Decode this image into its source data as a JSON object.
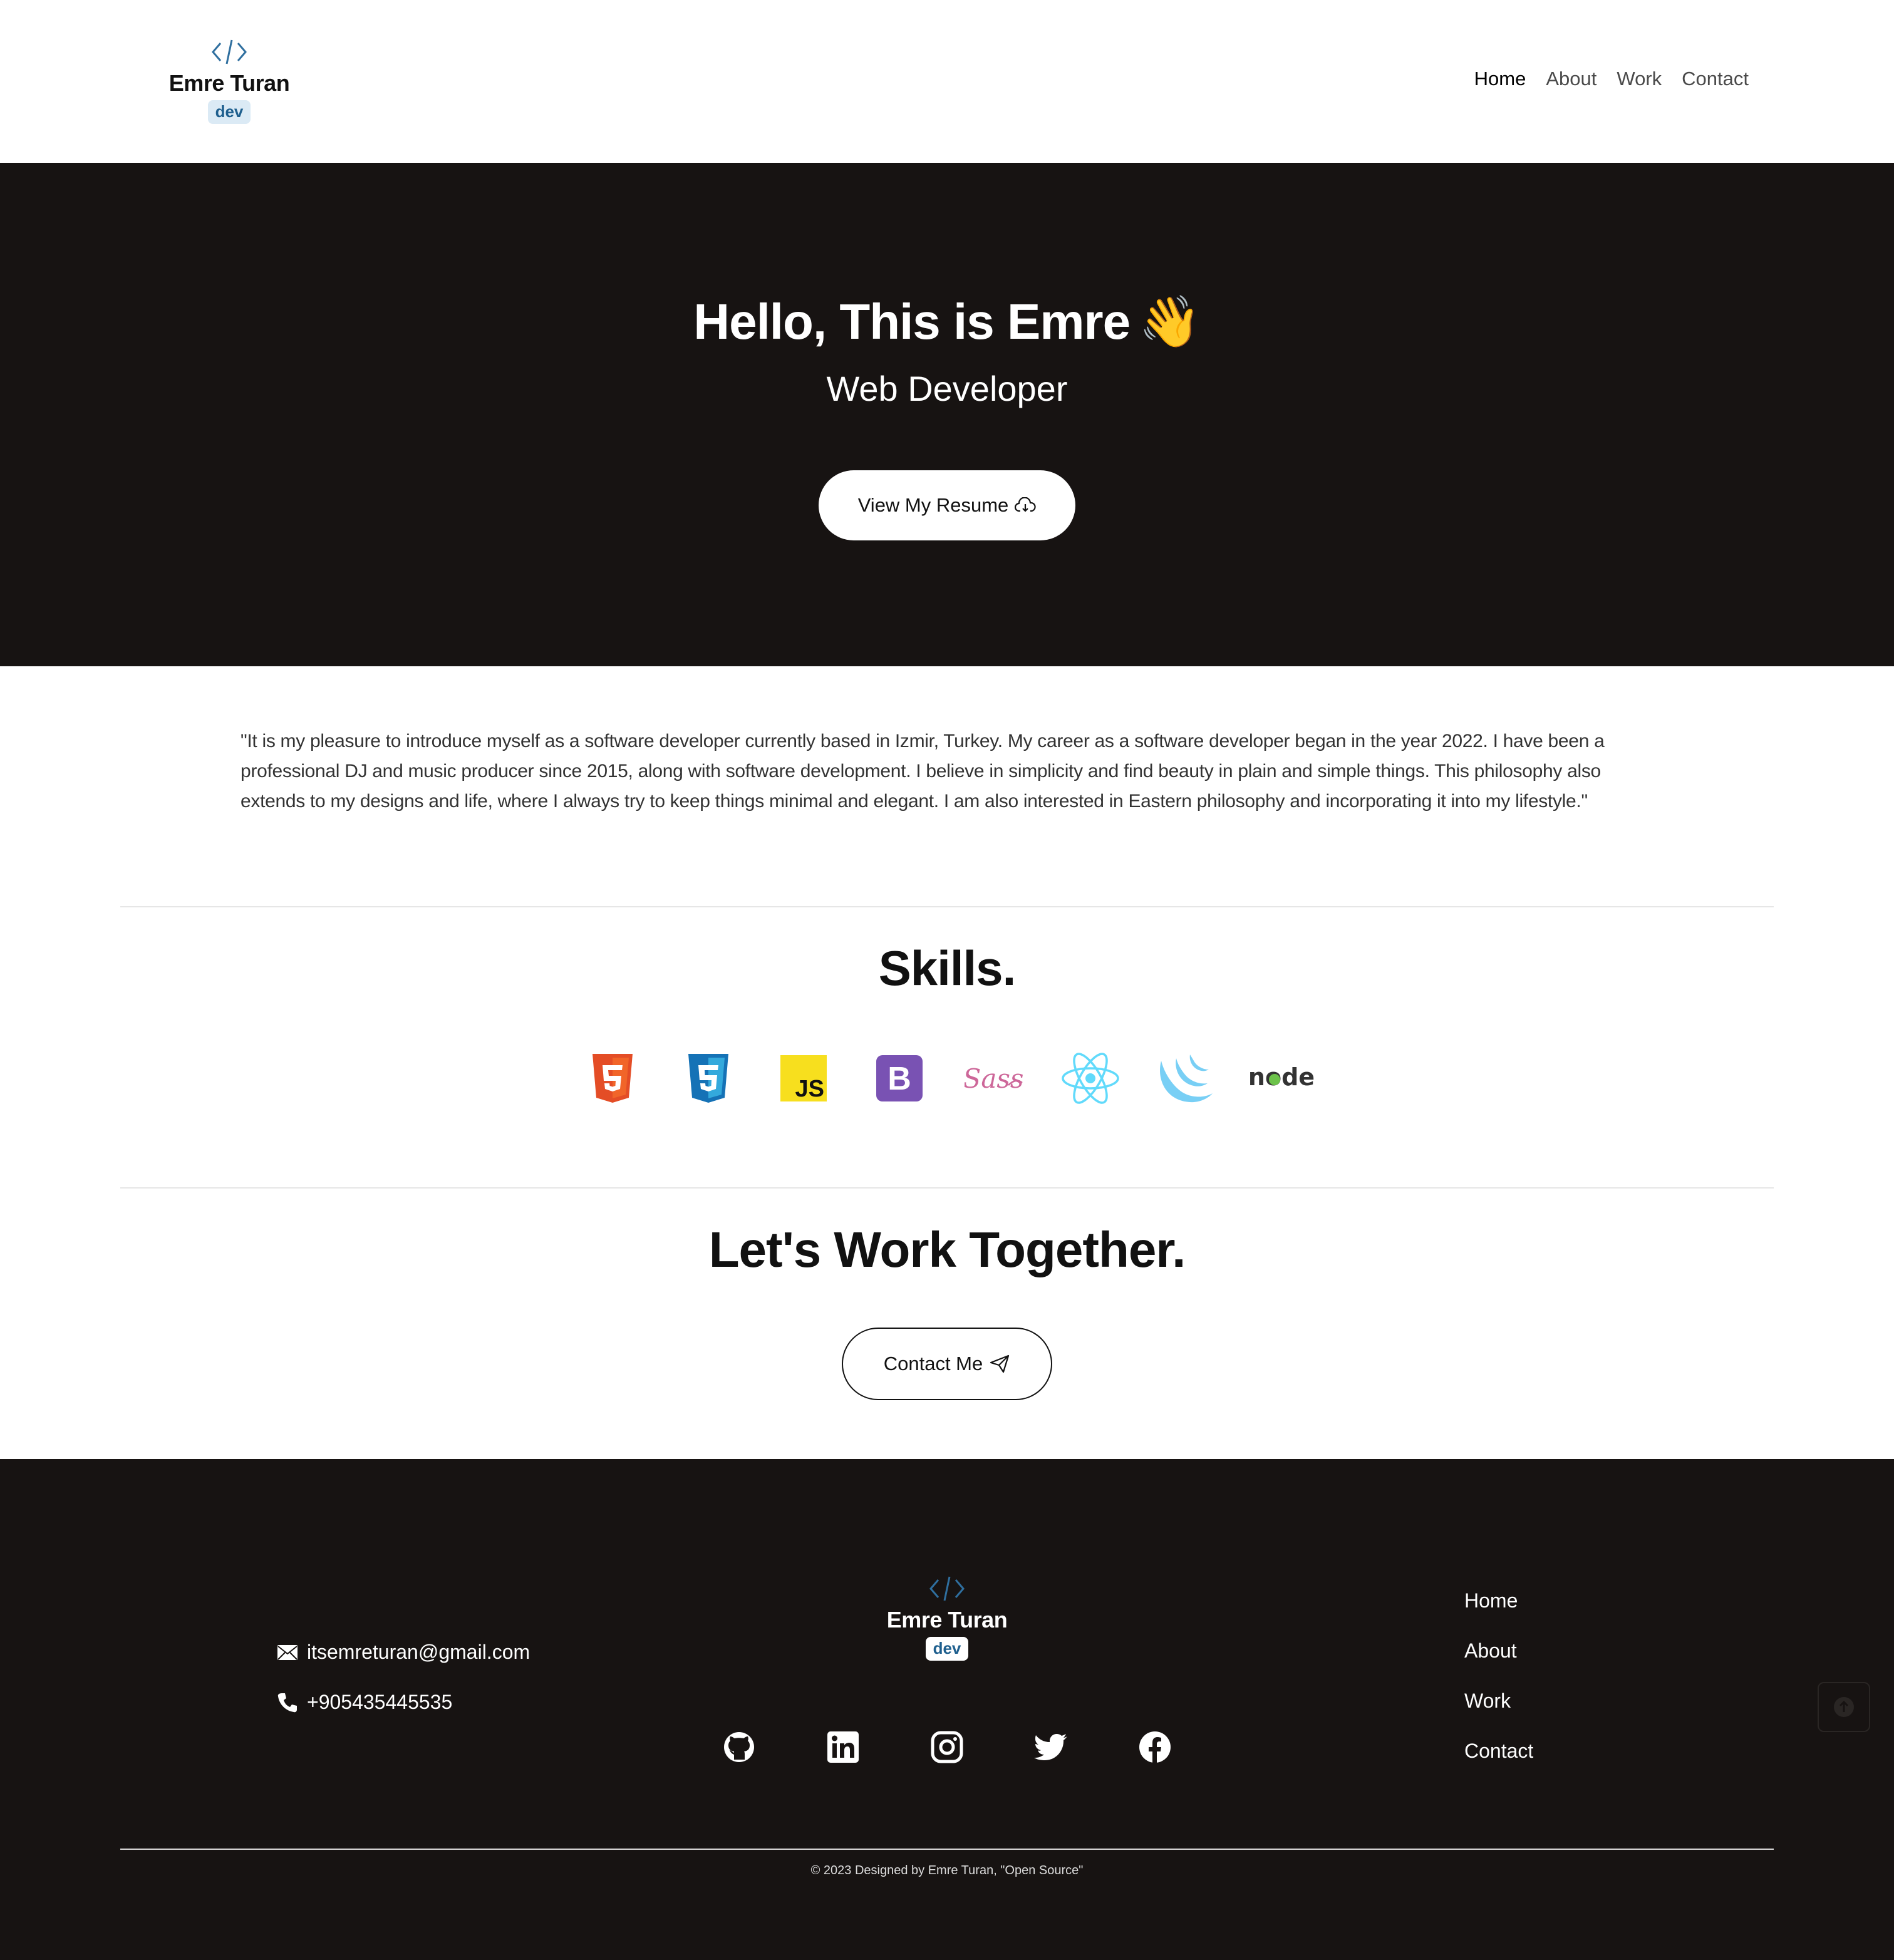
{
  "brand": {
    "name": "Emre Turan",
    "badge": "dev",
    "logo_icon": "code-icon",
    "accent_color": "#2f6f9f"
  },
  "nav": {
    "items": [
      "Home",
      "About",
      "Work",
      "Contact"
    ],
    "active": "Home"
  },
  "hero": {
    "title": "Hello, This is Emre",
    "title_emoji": "👋",
    "subtitle": "Web Developer",
    "resume_button": "View My Resume",
    "resume_icon": "cloud-download-icon",
    "background": "#171312"
  },
  "about": {
    "text": "\"It is my pleasure to introduce myself as a software developer currently based in Izmir, Turkey. My career as a software developer began in the year 2022. I have been a professional DJ and music producer since 2015, along with software development. I believe in simplicity and find beauty in plain and simple things. This philosophy also extends to my designs and life, where I always try to keep things minimal and elegant. I am also interested in Eastern philosophy and incorporating it into my lifestyle.\""
  },
  "skills": {
    "title": "Skills.",
    "icons": [
      {
        "name": "html5-icon",
        "label": "5",
        "color": "#e44d26"
      },
      {
        "name": "css3-icon",
        "label": "3",
        "color": "#1572b6"
      },
      {
        "name": "javascript-icon",
        "label": "JS",
        "color": "#f7df1e"
      },
      {
        "name": "bootstrap-icon",
        "label": "B",
        "color": "#7952b3"
      },
      {
        "name": "sass-icon",
        "label": "Sass",
        "color": "#cd6799"
      },
      {
        "name": "react-icon",
        "color": "#61dafb"
      },
      {
        "name": "jquery-icon",
        "color": "#78cff5"
      },
      {
        "name": "nodejs-icon",
        "label": "node",
        "color": "#333333"
      }
    ]
  },
  "work": {
    "title": "Let's Work Together.",
    "contact_button": "Contact Me",
    "contact_icon": "send-icon"
  },
  "footer": {
    "email": "itsemreturan@gmail.com",
    "email_icon": "mail-icon",
    "phone": "+905435445535",
    "phone_icon": "phone-icon",
    "nav": [
      "Home",
      "About",
      "Work",
      "Contact"
    ],
    "socials": [
      "github-icon",
      "linkedin-icon",
      "instagram-icon",
      "twitter-icon",
      "facebook-icon"
    ],
    "copyright": "© 2023 Designed by Emre Turan, \"Open Source\"",
    "scroll_top_icon": "arrow-up-icon"
  }
}
